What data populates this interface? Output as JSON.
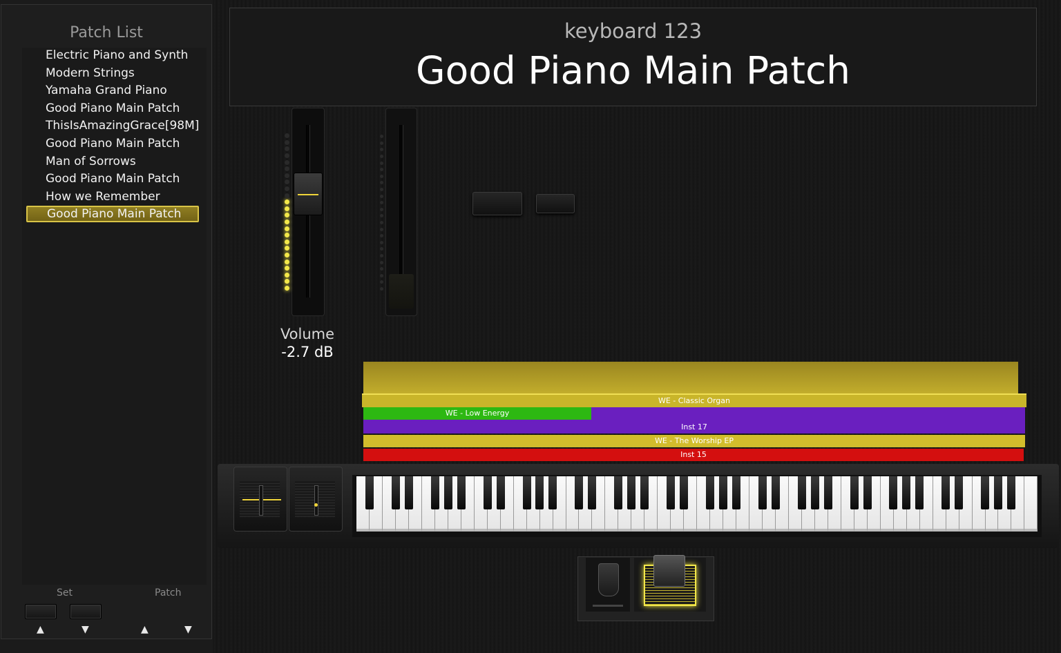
{
  "sidebar": {
    "title": "Patch List",
    "patches": [
      {
        "label": "Electric Piano and Synth",
        "selected": false
      },
      {
        "label": "Modern Strings",
        "selected": false
      },
      {
        "label": "Yamaha Grand Piano",
        "selected": false
      },
      {
        "label": "Good Piano Main Patch",
        "selected": false
      },
      {
        "label": "ThisIsAmazingGrace[98M]",
        "selected": false
      },
      {
        "label": "Good Piano Main Patch",
        "selected": false
      },
      {
        "label": "Man of Sorrows",
        "selected": false
      },
      {
        "label": "Good Piano Main Patch",
        "selected": false
      },
      {
        "label": "How we Remember",
        "selected": false
      },
      {
        "label": "Good Piano Main Patch",
        "selected": true
      }
    ],
    "set_label": "Set",
    "patch_label": "Patch",
    "up_arrow": "▲",
    "down_arrow": "▼"
  },
  "header": {
    "set_name": "keyboard 123",
    "patch_name": "Good Piano Main Patch"
  },
  "volume": {
    "label": "Volume",
    "value": "-2.7 dB",
    "meter_level": 0.57
  },
  "layers": [
    {
      "name": "WE - Classic Organ",
      "color": "#c9b52a"
    },
    {
      "name": "WE - Low Energy",
      "color": "#2db812"
    },
    {
      "name": "Inst 17",
      "color": "#6a1fbf"
    },
    {
      "name": "WE - The Worship EP",
      "color": "#d2bd2c"
    },
    {
      "name": "Inst 15",
      "color": "#d40f0f"
    }
  ],
  "colors": {
    "accent": "#f3e84a",
    "selected_bg": "#8a7820"
  }
}
